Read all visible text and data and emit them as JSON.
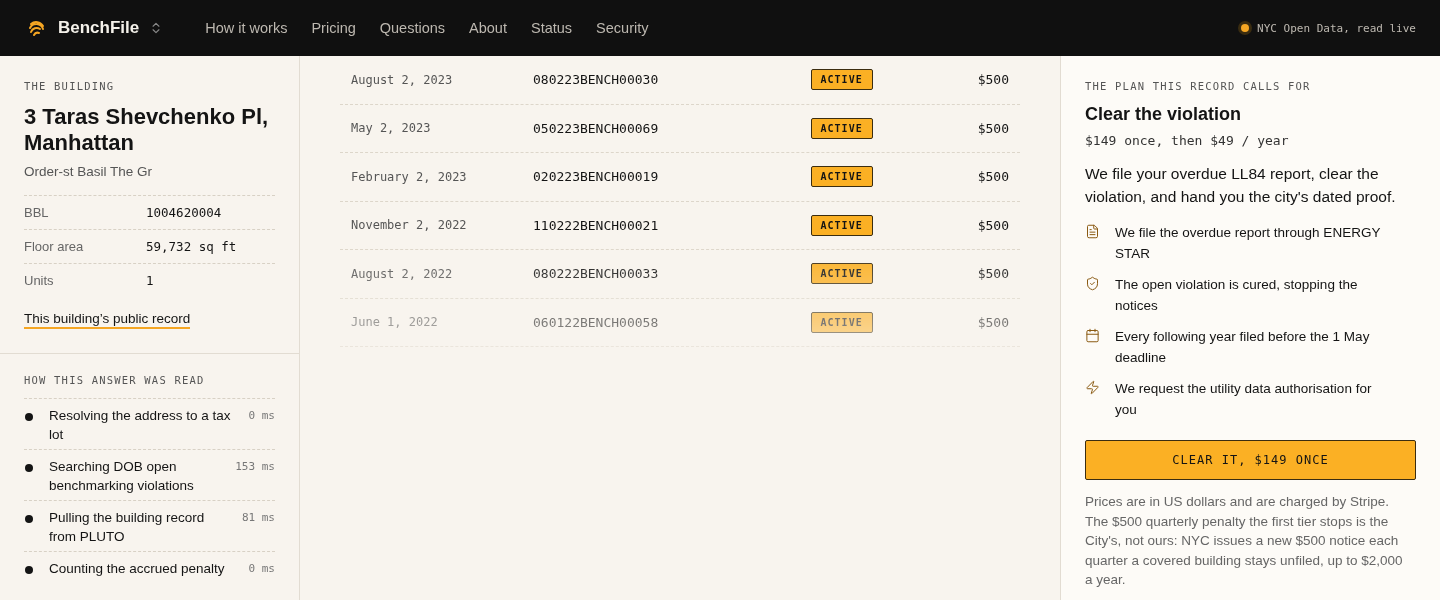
{
  "nav": {
    "brand": "BenchFile",
    "links": [
      "How it works",
      "Pricing",
      "Questions",
      "About",
      "Status",
      "Security"
    ],
    "status": "NYC Open Data, read live"
  },
  "building": {
    "eyebrow": "THE BUILDING",
    "address": "3 Taras Shevchenko Pl, Manhattan",
    "owner": "Order-st Basil The Gr",
    "facts": [
      {
        "label": "BBL",
        "value": "1004620004"
      },
      {
        "label": "Floor area",
        "value": "59,732 sq ft"
      },
      {
        "label": "Units",
        "value": "1"
      }
    ],
    "link": "This building’s public record"
  },
  "trace": {
    "eyebrow": "HOW THIS ANSWER WAS READ",
    "steps": [
      {
        "text": "Resolving the address to a tax lot",
        "time": "0 ms"
      },
      {
        "text": "Searching DOB open benchmarking violations",
        "time": "153 ms"
      },
      {
        "text": "Pulling the building record from PLUTO",
        "time": "81 ms"
      },
      {
        "text": "Counting the accrued penalty",
        "time": "0 ms"
      }
    ]
  },
  "violations": [
    {
      "date": "August 2, 2023",
      "id": "080223BENCH00030",
      "status": "ACTIVE",
      "amount": "$500"
    },
    {
      "date": "May 2, 2023",
      "id": "050223BENCH00069",
      "status": "ACTIVE",
      "amount": "$500"
    },
    {
      "date": "February 2, 2023",
      "id": "020223BENCH00019",
      "status": "ACTIVE",
      "amount": "$500"
    },
    {
      "date": "November 2, 2022",
      "id": "110222BENCH00021",
      "status": "ACTIVE",
      "amount": "$500"
    },
    {
      "date": "August 2, 2022",
      "id": "080222BENCH00033",
      "status": "ACTIVE",
      "amount": "$500"
    },
    {
      "date": "June 1, 2022",
      "id": "060122BENCH00058",
      "status": "ACTIVE",
      "amount": "$500"
    }
  ],
  "plan": {
    "eyebrow": "THE PLAN THIS RECORD CALLS FOR",
    "title": "Clear the violation",
    "price": "$149 once, then $49 / year",
    "summary": "We file your overdue LL84 report, clear the violation, and hand you the city's dated proof.",
    "features": [
      {
        "kind": "document",
        "text": "We file the overdue report through ENERGY STAR"
      },
      {
        "kind": "shield",
        "text": "The open violation is cured, stopping the notices"
      },
      {
        "kind": "calendar",
        "text": "Every following year filed before the 1 May deadline"
      },
      {
        "kind": "bolt",
        "text": "We request the utility data authorisation for you"
      }
    ],
    "button": "CLEAR IT, $149 ONCE",
    "note": "Prices are in US dollars and are charged by Stripe. The $500 quarterly penalty the first tier stops is the City's, not ours: NYC issues a new $500 notice each quarter a covered building stays unfiled, up to $2,000 a year."
  }
}
